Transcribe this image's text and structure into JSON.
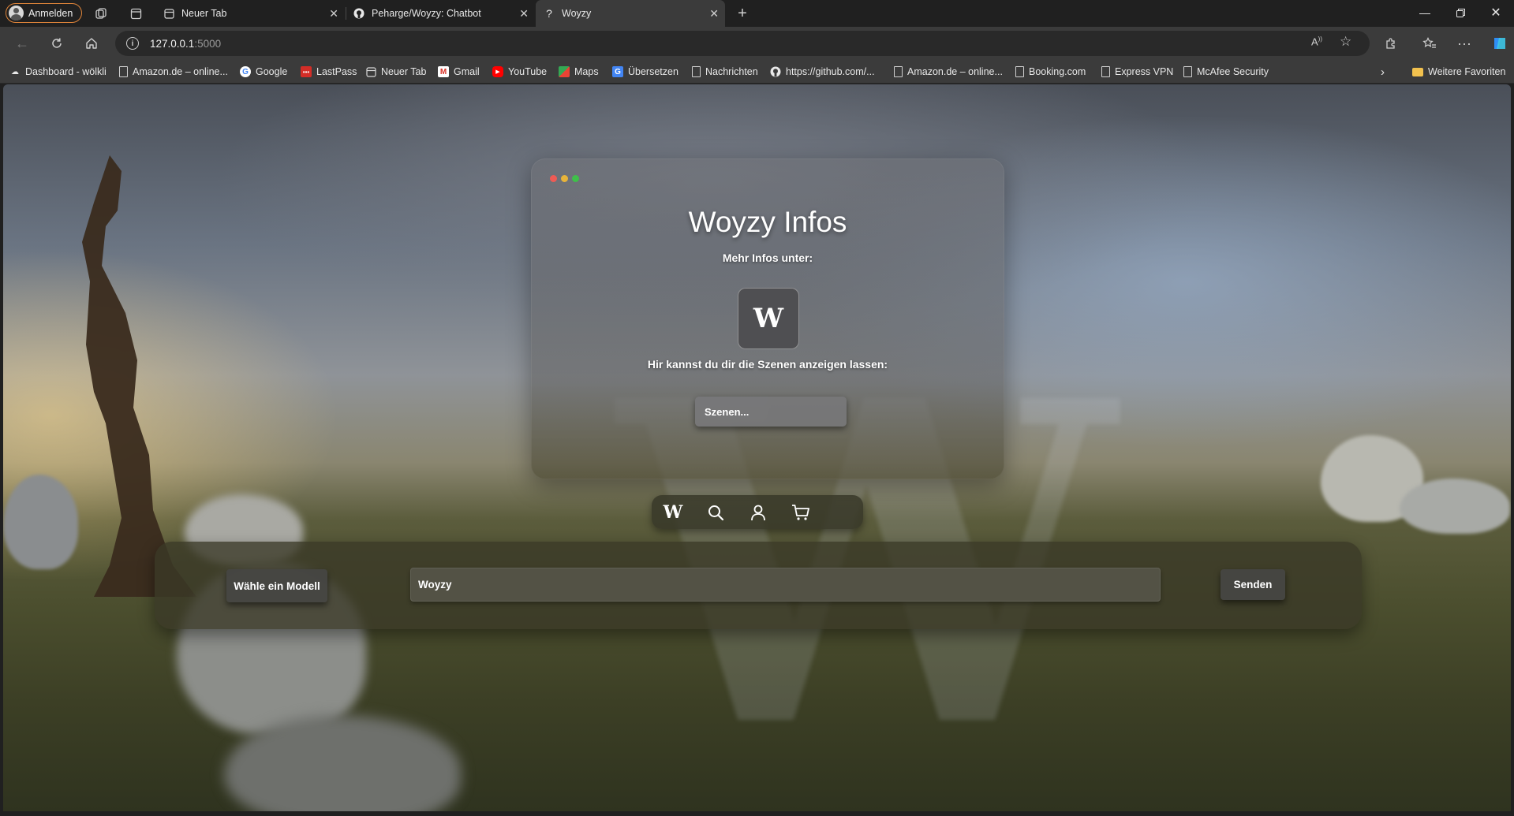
{
  "browser": {
    "profile_label": "Anmelden",
    "tabs": [
      {
        "title": "Neuer Tab",
        "icon": "page-icon"
      },
      {
        "title": "Peharge/Woyzy: Chatbot",
        "icon": "github-icon"
      },
      {
        "title": "Woyzy",
        "icon": "question-icon"
      }
    ],
    "address": {
      "host": "127.0.0.1",
      "port": ":5000"
    },
    "bookmarks": [
      {
        "label": "Dashboard - wölkli",
        "icon": "cloud-icon"
      },
      {
        "label": "Amazon.de – online...",
        "icon": "doc-icon"
      },
      {
        "label": "Google",
        "icon": "google-icon"
      },
      {
        "label": "LastPass",
        "icon": "lastpass-icon"
      },
      {
        "label": "Neuer Tab",
        "icon": "page-icon"
      },
      {
        "label": "Gmail",
        "icon": "gmail-icon"
      },
      {
        "label": "YouTube",
        "icon": "youtube-icon"
      },
      {
        "label": "Maps",
        "icon": "maps-icon"
      },
      {
        "label": "Übersetzen",
        "icon": "translate-icon"
      },
      {
        "label": "Nachrichten",
        "icon": "doc-icon"
      },
      {
        "label": "https://github.com/...",
        "icon": "github-icon"
      },
      {
        "label": "Amazon.de – online...",
        "icon": "doc-icon"
      },
      {
        "label": "Booking.com",
        "icon": "doc-icon"
      },
      {
        "label": "Express VPN",
        "icon": "doc-icon"
      },
      {
        "label": "McAfee Security",
        "icon": "doc-icon"
      }
    ],
    "other_favorites": "Weitere Favoriten"
  },
  "card": {
    "title": "Woyzy Infos",
    "more_info": "Mehr Infos unter:",
    "logo_letter": "W",
    "scenes_text": "Hir kannst du dir die Szenen anzeigen lassen:",
    "scenes_button": "Szenen..."
  },
  "navpill": {
    "items": [
      "woyzy-logo-icon",
      "search-icon",
      "user-icon",
      "cart-icon"
    ],
    "logo_letter": "W"
  },
  "composer": {
    "model_button": "Wähle ein Modell",
    "input_value": "Woyzy",
    "send_button": "Senden"
  },
  "colors": {
    "dot_red": "#ee5b55",
    "dot_yellow": "#e8b43a",
    "dot_green": "#3fbf4a",
    "profile_border": "#e0853a"
  }
}
